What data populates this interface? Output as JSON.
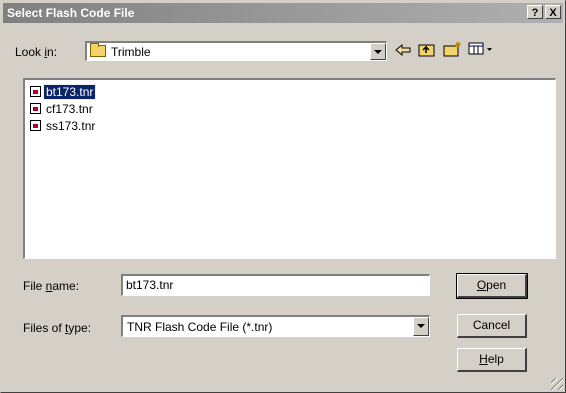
{
  "window": {
    "title": "Select Flash Code File",
    "help_btn": "?",
    "close_btn": "X"
  },
  "look_in": {
    "label_pre": "Look ",
    "label_key": "i",
    "label_post": "n:",
    "value": "Trimble"
  },
  "toolbar": {
    "back_icon": "back-arrow-icon",
    "up_icon": "up-folder-icon",
    "new_folder_icon": "new-folder-icon",
    "view_icon": "view-menu-icon"
  },
  "files": [
    {
      "name": "bt173.tnr",
      "selected": true
    },
    {
      "name": "cf173.tnr",
      "selected": false
    },
    {
      "name": "ss173.tnr",
      "selected": false
    }
  ],
  "file_name": {
    "label_pre": "File ",
    "label_key": "n",
    "label_post": "ame:",
    "value": "bt173.tnr"
  },
  "file_type": {
    "label_pre": "Files of ",
    "label_key": "t",
    "label_post": "ype:",
    "value": "TNR Flash Code File (*.tnr)"
  },
  "buttons": {
    "open_key": "O",
    "open_rest": "pen",
    "cancel": "Cancel",
    "help_key": "H",
    "help_rest": "elp"
  }
}
